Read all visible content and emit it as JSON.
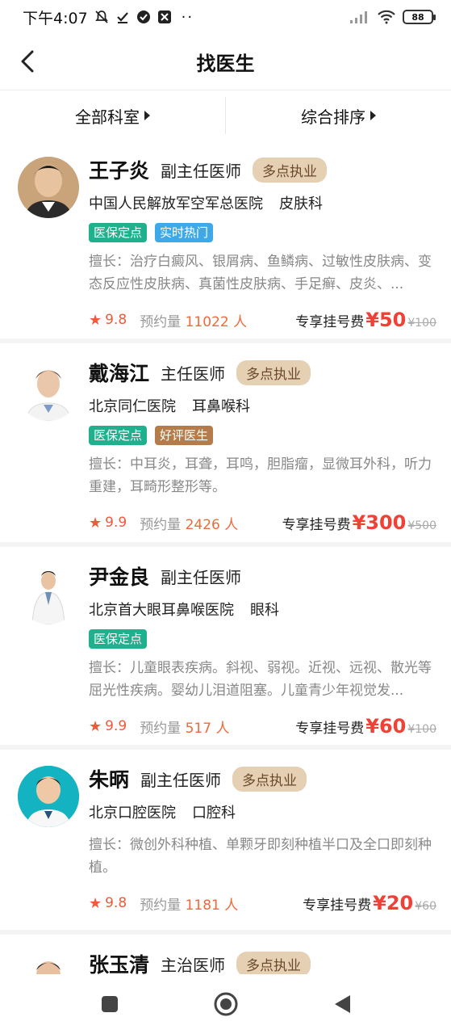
{
  "status_bar": {
    "time": "下午4:07",
    "dots": "··",
    "battery": "88"
  },
  "header": {
    "title": "找医生"
  },
  "filters": {
    "department": "全部科室",
    "sort": "综合排序"
  },
  "doctors": [
    {
      "name": "王子炎",
      "title": "副主任医师",
      "badge": "多点执业",
      "hospital": "中国人民解放军空军总医院",
      "department": "皮肤科",
      "tags": [
        {
          "text": "医保定点",
          "color": "#1fb18d"
        },
        {
          "text": "实时热门",
          "color": "#3da9e8"
        }
      ],
      "skill": "擅长：治疗白癜风、银屑病、鱼鳞病、过敏性皮肤病、变态反应性皮肤病、真菌性皮肤病、手足癣、皮炎、...",
      "rating": "9.8",
      "appt_label": "预约量",
      "appt_count": "11022 人",
      "fee_label": "专享挂号费",
      "price": "¥50",
      "old_price": "¥100"
    },
    {
      "name": "戴海江",
      "title": "主任医师",
      "badge": "多点执业",
      "hospital": "北京同仁医院",
      "department": "耳鼻喉科",
      "tags": [
        {
          "text": "医保定点",
          "color": "#1fb18d"
        },
        {
          "text": "好评医生",
          "color": "#b47c4b"
        }
      ],
      "skill": "擅长：中耳炎，耳聋，耳鸣，胆脂瘤，显微耳外科，听力重建，耳畸形整形等。",
      "rating": "9.9",
      "appt_label": "预约量",
      "appt_count": "2426 人",
      "fee_label": "专享挂号费",
      "price": "¥300",
      "old_price": "¥500"
    },
    {
      "name": "尹金良",
      "title": "副主任医师",
      "badge": "",
      "hospital": "北京首大眼耳鼻喉医院",
      "department": "眼科",
      "tags": [
        {
          "text": "医保定点",
          "color": "#1fb18d"
        }
      ],
      "skill": "擅长：儿童眼表疾病。斜视、弱视。近视、远视、散光等屈光性疾病。婴幼儿泪道阻塞。儿童青少年视觉发...",
      "rating": "9.9",
      "appt_label": "预约量",
      "appt_count": "517 人",
      "fee_label": "专享挂号费",
      "price": "¥60",
      "old_price": "¥100"
    },
    {
      "name": "朱昞",
      "title": "副主任医师",
      "badge": "多点执业",
      "hospital": "北京口腔医院",
      "department": "口腔科",
      "tags": [],
      "skill": "擅长：微创外科种植、单颗牙即刻种植半口及全口即刻种植。",
      "rating": "9.8",
      "appt_label": "预约量",
      "appt_count": "1181 人",
      "fee_label": "专享挂号费",
      "price": "¥20",
      "old_price": "¥60"
    },
    {
      "name": "张玉清",
      "title": "主治医师",
      "badge": "多点执业",
      "hospital": "",
      "department": "",
      "tags": [],
      "skill": "",
      "rating": "",
      "appt_label": "",
      "appt_count": "",
      "fee_label": "",
      "price": "",
      "old_price": ""
    }
  ],
  "icons": {
    "back": "back-arrow-icon",
    "star": "star-icon",
    "nav_square": "recent-apps-icon",
    "nav_circle": "home-icon",
    "nav_triangle": "back-icon"
  }
}
